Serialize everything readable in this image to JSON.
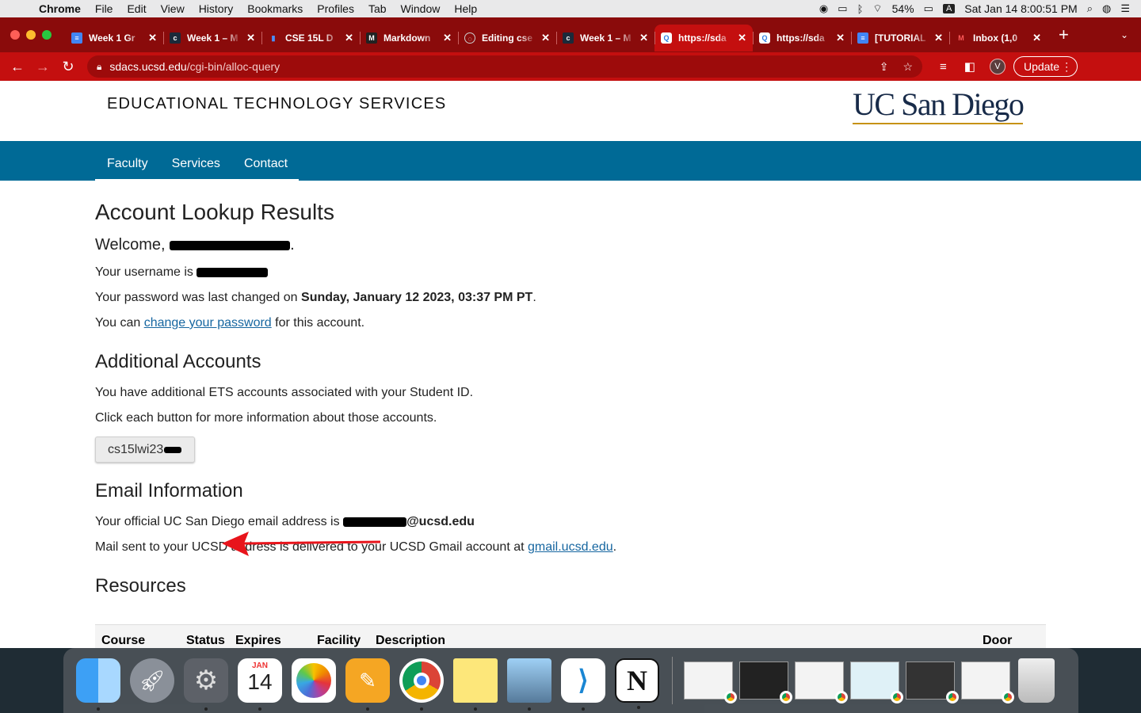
{
  "menubar": {
    "app": "Chrome",
    "items": [
      "File",
      "Edit",
      "View",
      "History",
      "Bookmarks",
      "Profiles",
      "Tab",
      "Window",
      "Help"
    ],
    "battery": "54%",
    "input_source": "A",
    "clock": "Sat Jan 14  8:00:51 PM"
  },
  "tabs": [
    {
      "title": "Week 1 Gr",
      "icon": "docs-icon",
      "color": "#4285f4"
    },
    {
      "title": "Week 1 – M",
      "icon": "cse-icon",
      "color": "#1b2a3a"
    },
    {
      "title": "CSE 15L D",
      "icon": "chart-icon",
      "color": "#1a73e8"
    },
    {
      "title": "Markdown",
      "icon": "markdown-icon",
      "color": "#222222"
    },
    {
      "title": "Editing cse",
      "icon": "github-icon",
      "color": "#333333"
    },
    {
      "title": "Week 1 – M",
      "icon": "cse-icon",
      "color": "#1b2a3a"
    },
    {
      "title": "https://sda",
      "icon": "search-page-icon",
      "color": "#2f7de1"
    },
    {
      "title": "https://sda",
      "icon": "search-page-icon",
      "color": "#2f7de1"
    },
    {
      "title": "[TUTORIAL",
      "icon": "docs-icon",
      "color": "#4285f4"
    },
    {
      "title": "Inbox (1,0",
      "icon": "gmail-icon",
      "color": "#d93025"
    }
  ],
  "toolbar": {
    "url_host": "sdacs.ucsd.edu",
    "url_path": "/cgi-bin/alloc-query",
    "profile_initial": "V",
    "update_label": "Update"
  },
  "site": {
    "title": "EDUCATIONAL TECHNOLOGY SERVICES",
    "logo": "UC San Diego",
    "nav": [
      "Faculty",
      "Services",
      "Contact"
    ]
  },
  "content": {
    "heading": "Account Lookup Results",
    "welcome_prefix": "Welcome,",
    "username_prefix": "Your username is",
    "password_prefix": "Your password was last changed on",
    "password_date": "Sunday, January 12 2023, 03:37 PM PT",
    "change_prefix": "You can",
    "change_link": "change your password",
    "change_suffix": "for this account.",
    "additional_heading": "Additional Accounts",
    "additional_text": "You have additional ETS accounts associated with your Student ID.",
    "additional_click": "Click each button for more information about those accounts.",
    "account_button": "cs15lwi23",
    "email_heading": "Email Information",
    "email_prefix": "Your official UC San Diego email address is",
    "email_domain": "@ucsd.edu",
    "mail_prefix": "Mail sent to your UCSD address is delivered to your UCSD Gmail account at",
    "mail_link": "gmail.ucsd.edu",
    "resources_heading": "Resources",
    "table_headers": [
      "Course",
      "Status",
      "Expires",
      "Facility",
      "Description",
      "Door"
    ]
  },
  "dock": {
    "calendar_month": "JAN",
    "calendar_day": "14",
    "apps": [
      "finder-icon",
      "launchpad-icon",
      "system-preferences-icon",
      "calendar-icon",
      "photos-icon",
      "pages-icon",
      "chrome-icon",
      "stickies-icon",
      "preview-icon",
      "vscode-icon",
      "notion-icon"
    ]
  },
  "colors": {
    "chrome_frame": "#8a0b0b",
    "chrome_active": "#c40f0f",
    "ets_nav": "#006a96",
    "ucsd_navy": "#182b49",
    "ucsd_gold": "#c69214",
    "link": "#1666a0",
    "arrow": "#e8141b"
  }
}
